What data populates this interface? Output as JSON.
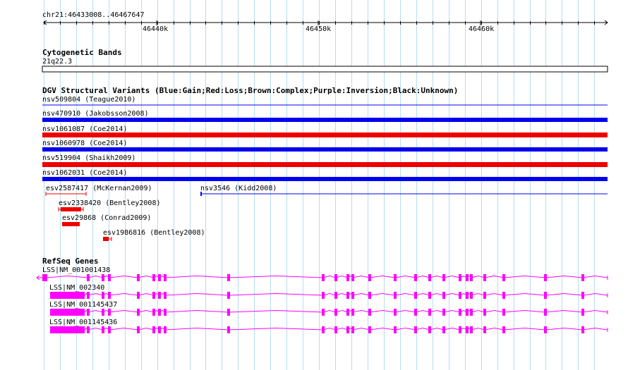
{
  "ruler": {
    "coords": "chr21:46433008..46467647",
    "ticks": [
      "46440k",
      "46450k",
      "46460k"
    ]
  },
  "cytoband": {
    "title": "Cytogenetic Bands",
    "band": "21q22.3"
  },
  "dgv": {
    "title": "DGV Structural Variants (Blue:Gain;Red:Loss;Brown:Complex;Purple:Inversion;Black:Unknown)",
    "legend": {
      "gain": "#0000ee",
      "loss": "#ee0000",
      "complex": "#8b4513",
      "inversion": "#8000a0",
      "unknown": "#000000"
    },
    "variants": [
      {
        "label": "nsv509804 (Teague2010)",
        "type": "gain"
      },
      {
        "label": "nsv470910 (Jakobsson2008)",
        "type": "gain"
      },
      {
        "label": "nsv1061087 (Coe2014)",
        "type": "loss"
      },
      {
        "label": "nsv1060978 (Coe2014)",
        "type": "gain"
      },
      {
        "label": "nsv519904 (Shaikh2009)",
        "type": "loss"
      },
      {
        "label": "nsv1062031 (Coe2014)",
        "type": "gain"
      },
      {
        "label": "esv2587417 (McKernan2009)",
        "type": "loss"
      },
      {
        "label": "nsv3546 (Kidd2008)",
        "type": "gain"
      },
      {
        "label": "esv2338420 (Bentley2008)",
        "type": "loss"
      },
      {
        "label": "esv29868 (Conrad2009)",
        "type": "loss"
      },
      {
        "label": "esv1986816 (Bentley2008)",
        "type": "loss"
      }
    ]
  },
  "refseq": {
    "title": "RefSeq Genes",
    "color": "#ff00ff",
    "genes": [
      {
        "label": "LSS|NM_001001438"
      },
      {
        "label": "LSS|NM_002340"
      },
      {
        "label": "LSS|NM_001145437"
      },
      {
        "label": "LSS|NM_001145436"
      }
    ]
  }
}
